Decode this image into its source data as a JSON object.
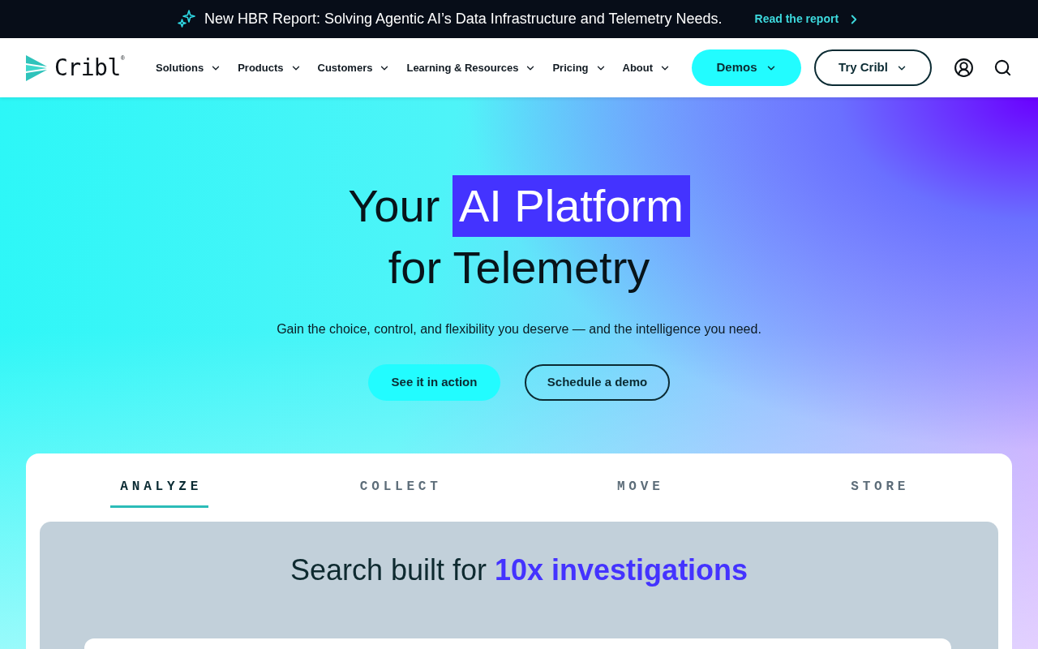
{
  "announcement": {
    "text": "New HBR Report: Solving Agentic AI’s Data Infrastructure and Telemetry Needs.",
    "link": "Read the report"
  },
  "nav": {
    "logo": {
      "text": "Cribl",
      "mark": "®"
    },
    "items": [
      {
        "label": "Solutions"
      },
      {
        "label": "Products"
      },
      {
        "label": "Customers"
      },
      {
        "label": "Learning & Resources"
      },
      {
        "label": "Pricing"
      },
      {
        "label": "About"
      }
    ],
    "buttons": [
      {
        "label": "Demos",
        "kind": "filled"
      },
      {
        "label": "Try Cribl",
        "kind": "outline"
      }
    ]
  },
  "hero": {
    "title": {
      "line_1": "Your",
      "highlight": "AI Platform",
      "line_2": "for Telemetry"
    },
    "subtitle": "Gain the choice, control, and flexibility you deserve — and the intelligence you need.",
    "buttons": [
      {
        "label": "See it in action",
        "kind": "filled"
      },
      {
        "label": "Schedule a demo",
        "kind": "outline"
      }
    ]
  },
  "tabs": [
    {
      "label": "ANALYZE",
      "selected": true
    },
    {
      "label": "COLLECT",
      "selected": false
    },
    {
      "label": "MOVE",
      "selected": false
    },
    {
      "label": "STORE",
      "selected": false
    }
  ],
  "panel": {
    "heading": "Search built for **10x investigations**"
  }
}
